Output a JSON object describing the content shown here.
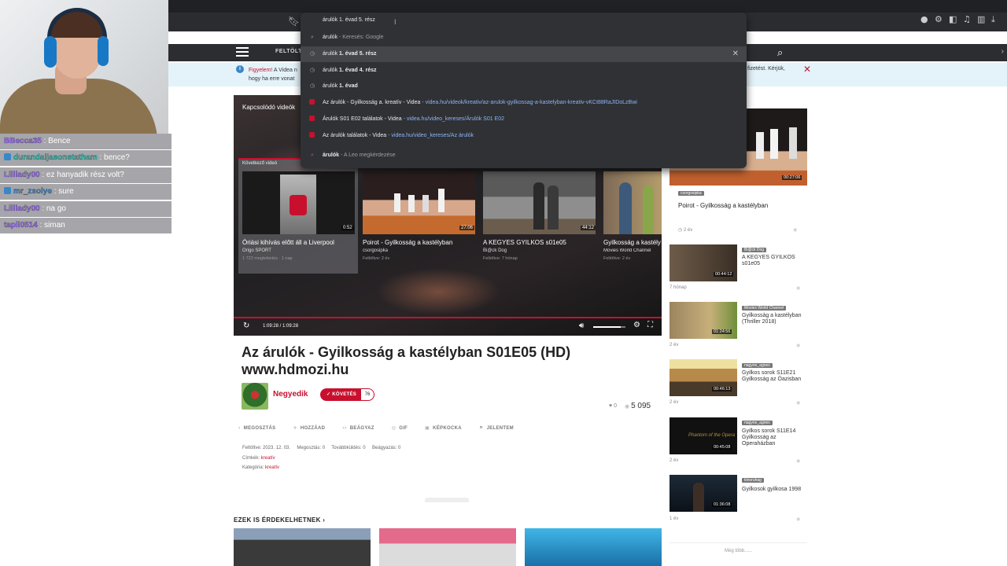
{
  "browser": {
    "address_input": "árulók 1. évad 5. rész",
    "suggestions": [
      {
        "type": "search",
        "prefix": "árulók",
        "suffix": " - Keresés: Google"
      },
      {
        "type": "history",
        "prefix": "árulók ",
        "bold": "1. évad 5. rész",
        "selected": true
      },
      {
        "type": "history",
        "prefix": "árulók ",
        "bold": "1. évad 4. rész"
      },
      {
        "type": "history",
        "prefix": "árulók ",
        "bold": "1. évad"
      },
      {
        "type": "site",
        "text": "Az árulók - Gyilkosság a. kreatív - Videa",
        "url": " - videa.hu/videok/kreativ/az-arulok-gyilkossag-a-kastelyban-kreativ-vKCt88RaJIDoLzBwi"
      },
      {
        "type": "site",
        "text": "Árulók S01 E02 találatok - Videa",
        "url": " - videa.hu/video_kereses/Árulók S01 E02"
      },
      {
        "type": "site",
        "text": "Az árulók találatok - Videa",
        "url": " - videa.hu/video_kereses/Az árulók"
      },
      {
        "type": "leo",
        "text": "árulók",
        "suffix": " - A Leo megkérdezése"
      }
    ]
  },
  "site": {
    "upload_label": "FELTÖLT",
    "notice": {
      "lead": "Figyelem!",
      "text": " A Videa n hogy ha erre vonat",
      "right": "fizetést. Kérjük,"
    }
  },
  "player": {
    "related_label": "Kapcsolódó videók",
    "up_next_label": "Következő videó",
    "cards": [
      {
        "title": "Óriási kihívás előtt áll a Liverpool",
        "channel": "Origo SPORT",
        "meta": "1 722 megtekintés · 1 nap",
        "duration": "0:52"
      },
      {
        "title": "Poirot - Gyilkosság a kastélyban",
        "channel": "csorgosipka",
        "meta": "Feltöltve: 2 év",
        "duration": "27:06"
      },
      {
        "title": "A KEGYES GYILKOS s01e05",
        "channel": "Bi@ck Dog",
        "meta": "Feltöltve: 7 hónap",
        "duration": "44:12"
      },
      {
        "title": "Gyilkosság a kastély",
        "channel": "Movies World Channel",
        "meta": "Feltöltve: 2 év",
        "duration": ""
      }
    ],
    "time": "1:09:28 / 1:09:28",
    "volume_fraction": 0.85
  },
  "video": {
    "title": "Az árulók - Gyilkosság a kastélyban S01E05 (HD) www.hdmozi.hu",
    "channel": "Negyedik",
    "follow_label": "KÖVETÉS",
    "followers": "76",
    "likes": "0",
    "views": "5 095",
    "actions": [
      "MEGOSZTÁS",
      "HOZZÁAD",
      "BEÁGYAZ",
      "GIF",
      "KÉPKOCKA",
      "JELENTEM"
    ],
    "meta": {
      "line1": "Feltöltve: 2023. 12. 03.     Megosztás: 0     Továbbküldés: 0     Beágyazás: 0",
      "tags_label": "Címkék: ",
      "tags_value": "kreatív",
      "category_label": "Kategória: ",
      "category_value": "kreatív"
    },
    "recommended_heading": "EZEK IS ÉRDEKELHETNEK"
  },
  "sidebar": {
    "items": [
      {
        "title": "Poirot - Gyilkosság a kastélyban",
        "tag": "csorgosipka",
        "duration": "00:27:06",
        "age": "2 év"
      },
      {
        "title": "A KEGYES GYILKOS s01e05",
        "tag": "Bi@ck Dog",
        "duration": "00:44:12",
        "age": "7 hónap"
      },
      {
        "title": "Gyilkosság a kastélyban (Thriller 2018)",
        "tag": "Movies World Channel",
        "duration": "01:24:56",
        "age": "2 év"
      },
      {
        "title": "Gyilkos sorok S11E21 Gyilkosság az Óazisban",
        "tag": "nagyne_agnes",
        "duration": "00:46:13",
        "age": "2 év"
      },
      {
        "title": "Gyilkos sorok S11E14 Gyilkosság az Operaházban",
        "tag": "nagyne_agnes",
        "duration": "00:45:08",
        "age": "2 év"
      },
      {
        "title": "Gyilkosok gyilkosa 1998",
        "tag": "kinoruhag",
        "duration": "01:36:08",
        "age": "1 év"
      }
    ],
    "more_label": "Még több......"
  },
  "stream": {
    "chat": [
      {
        "user": "BBecca35",
        "message": " : Bence",
        "color": "#9b6cff"
      },
      {
        "user": "durandaljasonstatham",
        "message": " : bence?",
        "color": "#2ec4b6",
        "badge": true
      },
      {
        "user": "Lilllady00",
        "message": " : ez hanyadik rész volt?",
        "color": "#9b6cff"
      },
      {
        "user": "mr_zsolye",
        "message": " : sure",
        "color": "#3a86c8",
        "badge": true
      },
      {
        "user": "Lilllady00",
        "message": " : na go",
        "color": "#9b6cff"
      },
      {
        "user": "tapli0514",
        "message": " : siman",
        "color": "#9b6cff"
      }
    ]
  }
}
